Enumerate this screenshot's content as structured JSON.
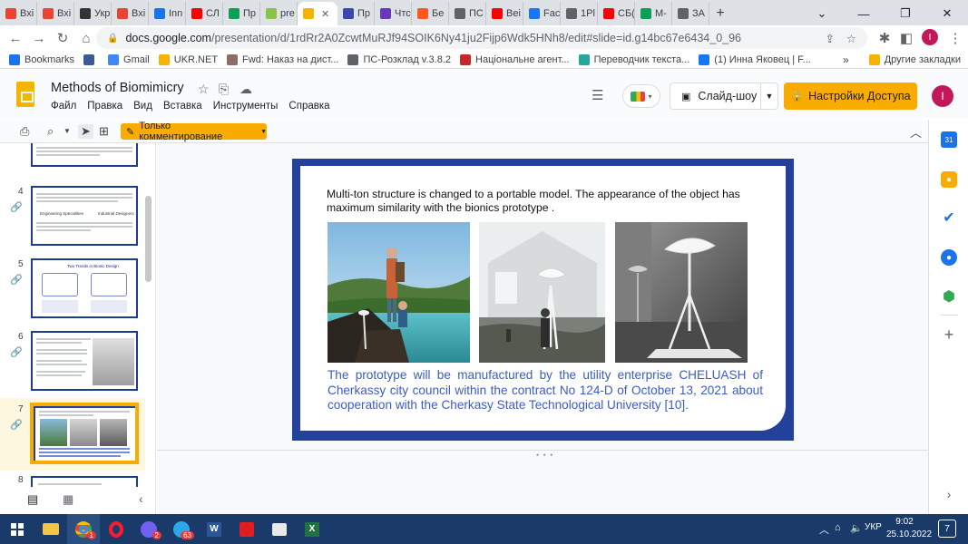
{
  "browser": {
    "tabs": [
      {
        "label": "Вхі",
        "icon": "gmail-icon",
        "color": "#ea4335"
      },
      {
        "label": "Вхі",
        "icon": "gmail-icon",
        "color": "#ea4335"
      },
      {
        "label": "Укр",
        "icon": "ukr-icon",
        "color": "#333333"
      },
      {
        "label": "Вхі",
        "icon": "gmail-icon",
        "color": "#ea4335"
      },
      {
        "label": "Inn",
        "icon": "innovation-icon",
        "color": "#1a73e8"
      },
      {
        "label": "СЛ",
        "icon": "youtube-icon",
        "color": "#ff0000"
      },
      {
        "label": "Пр",
        "icon": "classroom-icon",
        "color": "#0f9d58"
      },
      {
        "label": "pre",
        "icon": "slides-tab-icon",
        "color": "#8bc34a"
      },
      {
        "label": "",
        "icon": "slides-icon",
        "color": "#f4b400",
        "active": true
      },
      {
        "label": "Пр",
        "icon": "tab-icon",
        "color": "#3949ab"
      },
      {
        "label": "Чтс",
        "icon": "tab-icon",
        "color": "#673ab7"
      },
      {
        "label": "Бе",
        "icon": "tab-icon",
        "color": "#ff5722"
      },
      {
        "label": "ПС",
        "icon": "globe-icon",
        "color": "#5f6368"
      },
      {
        "label": "Веі",
        "icon": "youtube-icon",
        "color": "#ff0000"
      },
      {
        "label": "Fac",
        "icon": "facebook-icon",
        "color": "#1877f2"
      },
      {
        "label": "1Pl",
        "icon": "globe-icon",
        "color": "#5f6368"
      },
      {
        "label": "СБ(",
        "icon": "youtube-icon",
        "color": "#ff0000"
      },
      {
        "label": "М-",
        "icon": "drive-icon",
        "color": "#0f9d58"
      },
      {
        "label": "ЗА",
        "icon": "globe-icon",
        "color": "#5f6368"
      }
    ],
    "new_tab": "+",
    "url_host": "docs.google.com",
    "url_path": "/presentation/d/1rdRr2A0ZcwtMuRJf94SOIK6Ny41ju2Fijp6Wdk5HNh8/edit#slide=id.g14bc67e6434_0_96",
    "bookmarks": [
      {
        "label": "Bookmarks",
        "icon": "star-icon",
        "color": "#1a73e8"
      },
      {
        "label": "",
        "icon": "bookmark-b-icon",
        "color": "#3b5998"
      },
      {
        "label": "Gmail",
        "icon": "google-icon",
        "color": "#4285f4"
      },
      {
        "label": "UKR.NET",
        "icon": "ukrnet-icon",
        "color": "#f4b400"
      },
      {
        "label": "Fwd: Наказ на дист...",
        "icon": "mail-icon",
        "color": "#8d6e63"
      },
      {
        "label": "ПС-Розклад v.3.8.2",
        "icon": "globe-icon",
        "color": "#5f6368"
      },
      {
        "label": "Національне агент...",
        "icon": "agency-icon",
        "color": "#c62828"
      },
      {
        "label": "Переводчик текста...",
        "icon": "translate-icon",
        "color": "#26a69a"
      },
      {
        "label": "(1) Инна Яковец | F...",
        "icon": "facebook-icon",
        "color": "#1877f2"
      }
    ],
    "bookmarks_more": "»",
    "other_bookmarks": "Другие закладки"
  },
  "docs": {
    "title": "Methods of Biomimicry",
    "menu": [
      "Файл",
      "Правка",
      "Вид",
      "Вставка",
      "Инструменты",
      "Справка"
    ],
    "slideshow_label": "Слайд-шоу",
    "access_label": "Настройки Доступа",
    "avatar_letter": "I",
    "comment_only_label": "Только комментирование"
  },
  "filmstrip": {
    "thumbs": [
      {
        "number": "4"
      },
      {
        "number": "5"
      },
      {
        "number": "6"
      },
      {
        "number": "7",
        "selected": true
      },
      {
        "number": "8"
      }
    ],
    "thumb4_text_a": "Engineering Specialities",
    "thumb4_text_b": "Industrial Designers",
    "thumb5_title": "Two Trends in Bionic Design"
  },
  "slide": {
    "top_text": "Multi-ton structure is changed to a portable model. The appearance of the object has maximum similarity with the bionics prototype .",
    "caption": "The prototype will be manufactured by the utility enterprise CHELUASH of Cherkassy city council within the contract No 124-D of October 13, 2021 about cooperation with the Cherkasy State Technological University [10].",
    "photos": [
      "photo-hikers-lake",
      "photo-device-building",
      "photo-device-studio"
    ]
  },
  "taskbar": {
    "clock_time": "9:02",
    "clock_date": "25.10.2022",
    "lang": "УКР",
    "badges": {
      "chrome": "1",
      "viber": "2",
      "telegram": "63"
    },
    "notification_count": "7"
  }
}
